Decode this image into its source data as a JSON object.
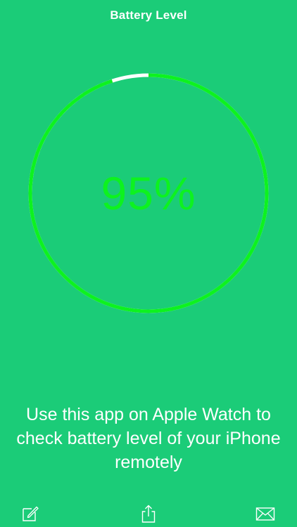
{
  "nav": {
    "title": "Battery Level"
  },
  "gauge": {
    "percent": 95,
    "label": "95%",
    "ring_color": "#0df21f",
    "remaining_color": "#ffffff",
    "text_color": "#0df21f"
  },
  "message": {
    "text": "Use this app on Apple Watch to check battery level of your iPhone remotely"
  },
  "toolbar": {
    "compose_icon": "compose-icon",
    "share_icon": "share-icon",
    "mail_icon": "mail-icon"
  },
  "theme": {
    "background": "#1bcc78",
    "foreground": "#ffffff"
  }
}
